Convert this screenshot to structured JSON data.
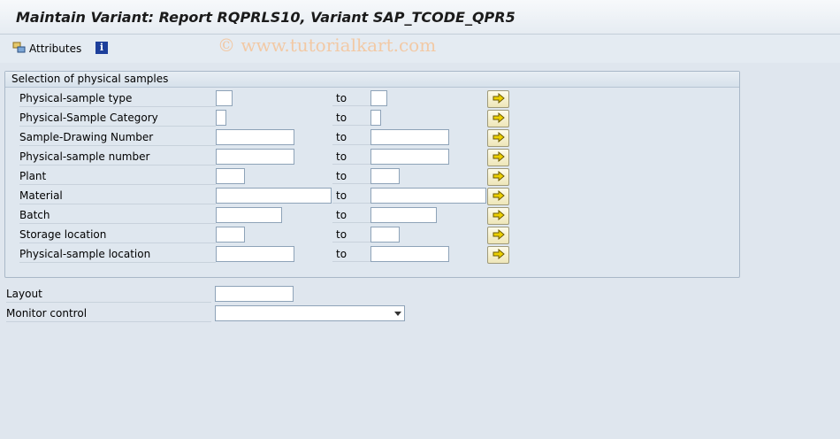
{
  "title": "Maintain Variant: Report RQPRLS10, Variant SAP_TCODE_QPR5",
  "toolbar": {
    "attributes_label": "Attributes",
    "info_icon": "info-icon",
    "info_glyph": "i"
  },
  "watermark": "© www.tutorialkart.com",
  "group": {
    "title": "Selection of physical samples",
    "to_label": "to",
    "rows": [
      {
        "label": "Physical-sample type",
        "from": "",
        "to": ""
      },
      {
        "label": "Physical-Sample Category",
        "from": "",
        "to": ""
      },
      {
        "label": "Sample-Drawing Number",
        "from": "",
        "to": ""
      },
      {
        "label": "Physical-sample number",
        "from": "",
        "to": ""
      },
      {
        "label": "Plant",
        "from": "",
        "to": ""
      },
      {
        "label": "Material",
        "from": "",
        "to": ""
      },
      {
        "label": "Batch",
        "from": "",
        "to": ""
      },
      {
        "label": "Storage location",
        "from": "",
        "to": ""
      },
      {
        "label": "Physical-sample location",
        "from": "",
        "to": ""
      }
    ]
  },
  "layout": {
    "label": "Layout",
    "value": ""
  },
  "monitor_control": {
    "label": "Monitor control",
    "value": ""
  },
  "colors": {
    "background": "#dfe6ee",
    "multi_select_button": "#f3ecc3",
    "arrow": "#e8c400"
  }
}
